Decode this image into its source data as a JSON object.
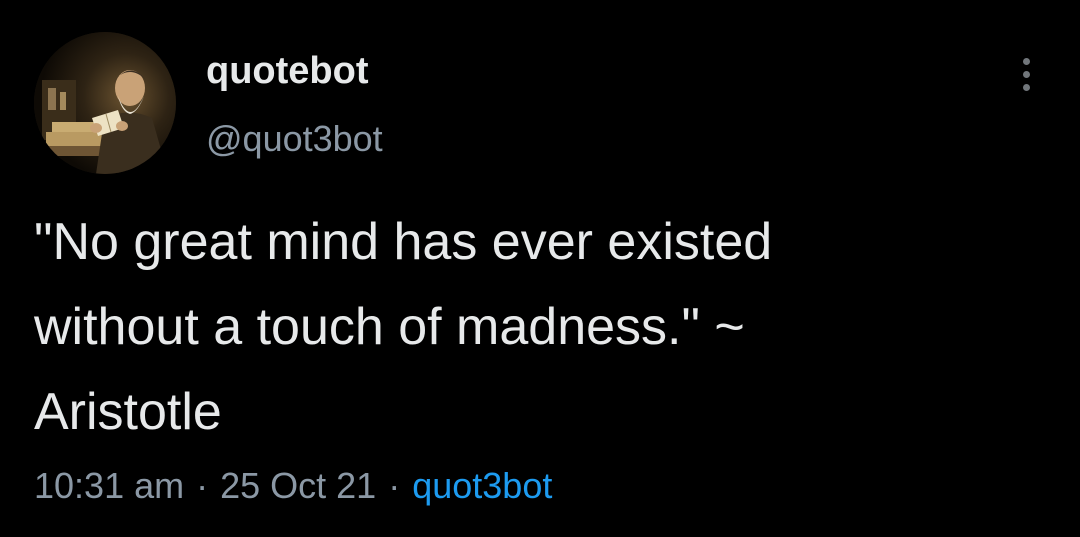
{
  "tweet": {
    "author": {
      "display_name": "quotebot",
      "handle": "@quot3bot",
      "avatar_icon": "scholar-painting-avatar"
    },
    "more_icon": "more-vertical-icon",
    "text_lines": [
      "\"No great mind has ever existed",
      "without a touch of madness.\" ~",
      "Aristotle"
    ],
    "time": "10:31 am",
    "separator": "·",
    "date": "25 Oct 21",
    "source": "quot3bot"
  },
  "colors": {
    "background": "#000000",
    "primary_text": "#e7e9ea",
    "secondary_text": "#8b98a5",
    "link": "#1d9bf0"
  }
}
